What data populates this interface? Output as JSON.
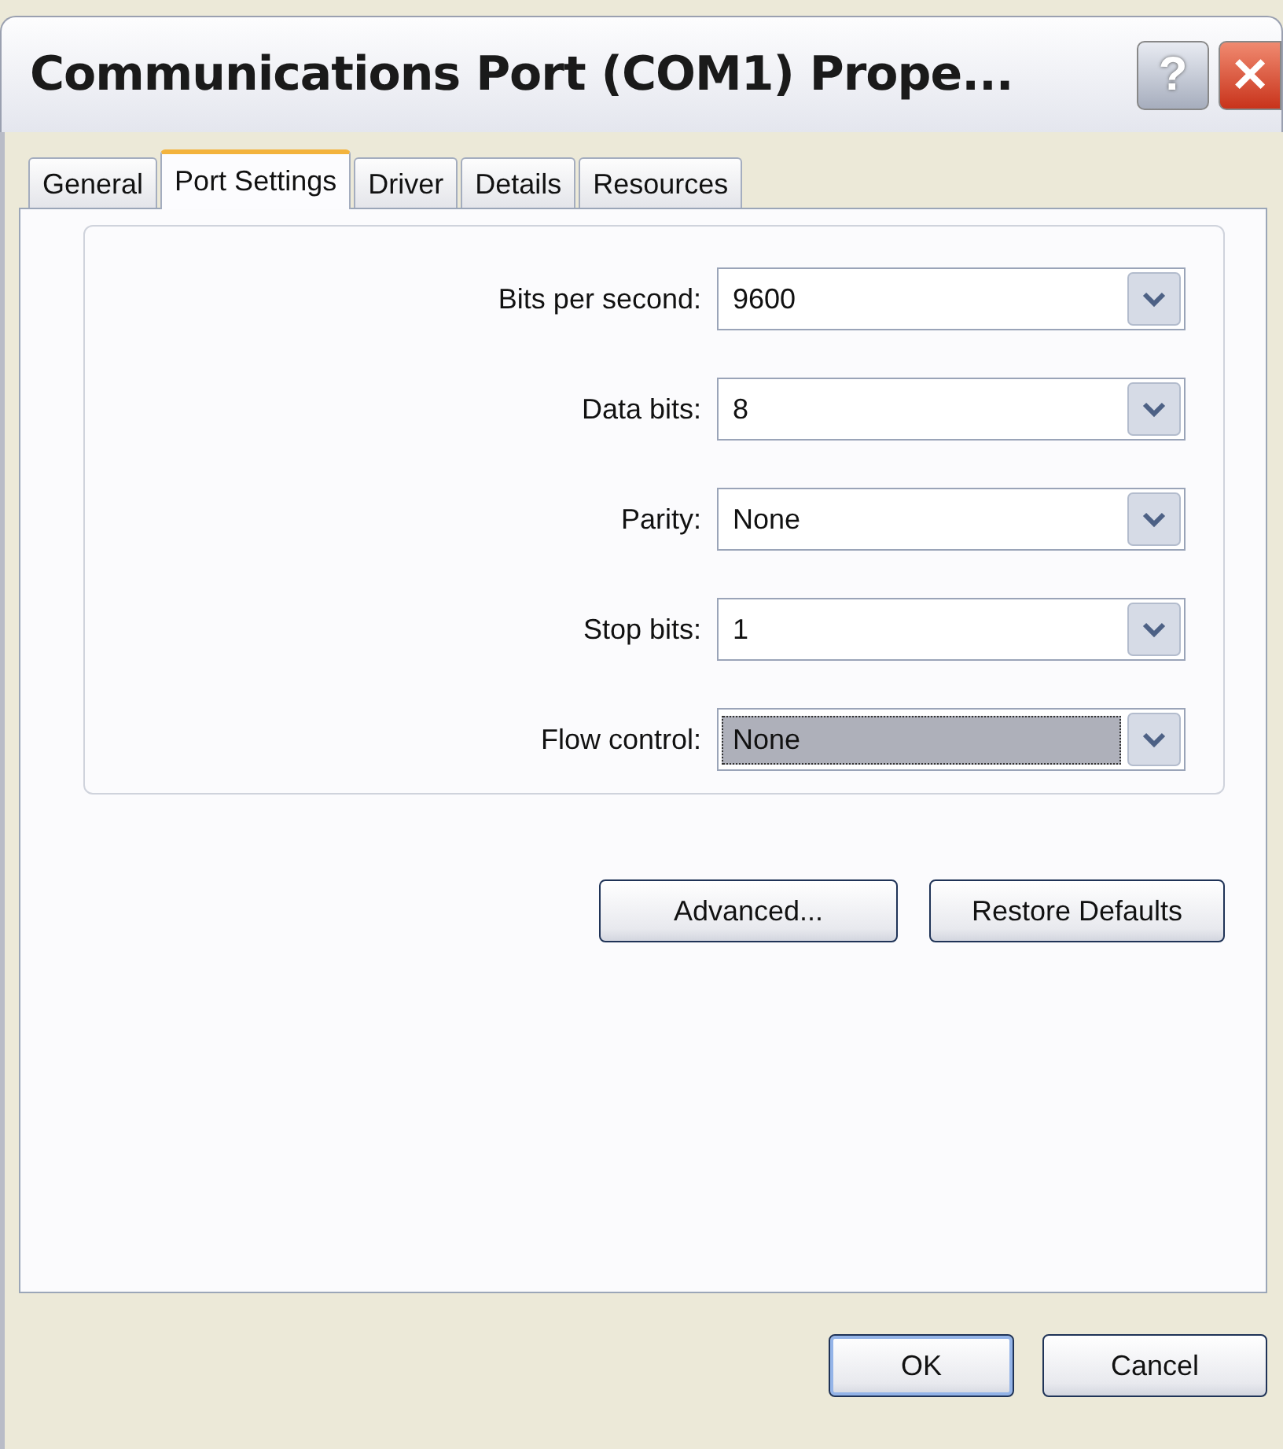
{
  "window": {
    "title": "Communications Port (COM1) Prope..."
  },
  "title_buttons": [
    {
      "kind": "help",
      "label": "?"
    },
    {
      "kind": "close",
      "label": "✕"
    }
  ],
  "tabs": [
    {
      "label": "General",
      "selected": false
    },
    {
      "label": "Port Settings",
      "selected": true
    },
    {
      "label": "Driver",
      "selected": false
    },
    {
      "label": "Details",
      "selected": false
    },
    {
      "label": "Resources",
      "selected": false
    }
  ],
  "settings": [
    {
      "label": "Bits per second:",
      "value": "9600",
      "focused": false
    },
    {
      "label": "Data bits:",
      "value": "8",
      "focused": false
    },
    {
      "label": "Parity:",
      "value": "None",
      "focused": false
    },
    {
      "label": "Stop bits:",
      "value": "1",
      "focused": false
    },
    {
      "label": "Flow control:",
      "value": "None",
      "focused": true
    }
  ],
  "page_buttons": [
    "Advanced...",
    "Restore Defaults"
  ],
  "dialog_buttons": [
    {
      "label": "OK",
      "default": true
    },
    {
      "label": "Cancel",
      "default": false
    }
  ]
}
